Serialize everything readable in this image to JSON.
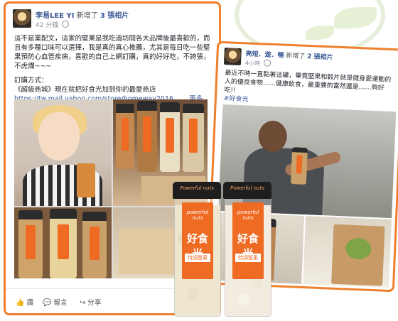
{
  "colors": {
    "accent": "#f07f2b",
    "label_orange": "#ef6b23",
    "link": "#3b5998"
  },
  "post1": {
    "author": "李易LEE YI",
    "action": "新增了",
    "photos_count": "3 張相片",
    "time": "42 分鐘",
    "paragraph1": "這不是業配文，這家的堅果是我吃過坊間各大品牌後最喜歡的，而且有多種口味可以選擇，我是真的真心推薦，尤其是每日吃一些堅果預防心血管疾病，喜歡的自己上網訂購，真的好好吃，不誇張，不虎爛~~~",
    "order_label": "訂購方式：",
    "store_line": "《超級商城》現在就把好食光加到你的最愛商店",
    "url": "https://tw.mall.yahoo.com/store/homeway2016",
    "ellipsis": "……",
    "more": "更多",
    "actions": {
      "like": "讚",
      "comment": "留言",
      "share": "分享"
    }
  },
  "post2": {
    "author": "亮短．遊．暢",
    "action": "新增了",
    "photos_count": "2 張相片",
    "time": "4小時",
    "text": "最近不時一直黏著這罐，畢竟堅果和穀片就是健身愛運動的人的優良食物……健康飲食，最重要的當然還是……夠好吃!!",
    "hashtag": "#好食光"
  },
  "jar": {
    "cap_text": "Powerful nuts",
    "brand": "好食光",
    "sub": "特調堅果",
    "script": "powerful nuts"
  }
}
